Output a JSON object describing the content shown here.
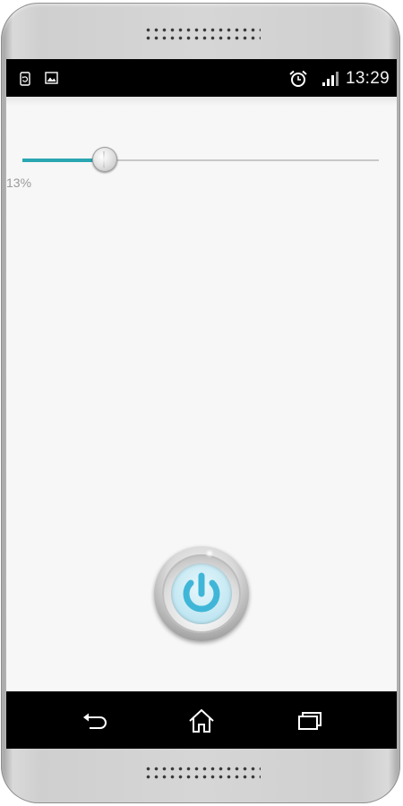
{
  "status_bar": {
    "left_icons": [
      "screen-rotation-icon",
      "image-icon"
    ],
    "right_icons": [
      "alarm-clock-icon",
      "signal-strength-icon"
    ],
    "time": "13:29"
  },
  "brightness": {
    "value_label": "13%",
    "value_fraction": 0.13,
    "accent_color": "#2aa7b1"
  },
  "power_button": {
    "icon": "power-icon",
    "glow_color": "#3fb6d8"
  },
  "nav_bar": {
    "buttons": [
      "back-icon",
      "home-icon",
      "recent-apps-icon"
    ]
  },
  "colors": {
    "background": "#f7f7f7",
    "track": "#c8c8c8",
    "bars": "#000000"
  }
}
